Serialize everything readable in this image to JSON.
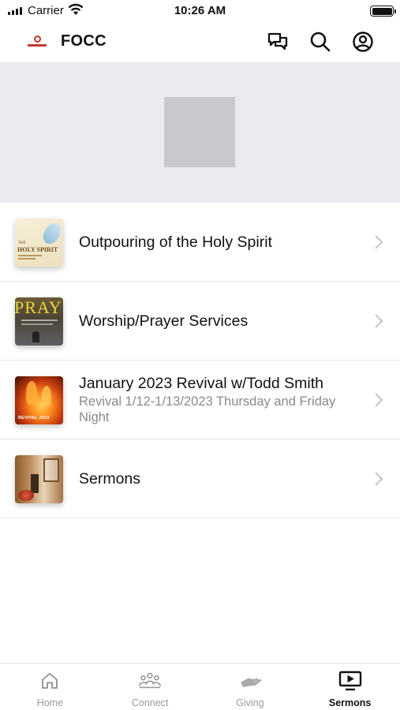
{
  "status_bar": {
    "carrier": "Carrier",
    "time": "10:26 AM",
    "icons": [
      "signal-icon",
      "wifi-icon",
      "battery-icon"
    ]
  },
  "header": {
    "title": "FOCC",
    "logo": "church-logo",
    "buttons": [
      "chat-icon",
      "search-icon",
      "profile-icon"
    ]
  },
  "banner": {
    "image": "placeholder-image"
  },
  "list": {
    "items": [
      {
        "title": "Outpouring of the Holy Spirit",
        "subtitle": "",
        "thumbnail_text": [
          "THE",
          "HOLY SPIRIT"
        ]
      },
      {
        "title": "Worship/Prayer Services",
        "subtitle": "",
        "thumbnail_text": [
          "PRAY"
        ]
      },
      {
        "title": "January 2023 Revival w/Todd Smith",
        "subtitle": "Revival 1/12-1/13/2023 Thursday and Friday Night",
        "thumbnail_text": [
          "REVIVAL 2023"
        ]
      },
      {
        "title": "Sermons",
        "subtitle": "",
        "thumbnail_text": []
      }
    ]
  },
  "tabbar": {
    "tabs": [
      {
        "label": "Home",
        "icon": "home-icon",
        "active": false
      },
      {
        "label": "Connect",
        "icon": "people-icon",
        "active": false
      },
      {
        "label": "Giving",
        "icon": "giving-hand-icon",
        "active": false
      },
      {
        "label": "Sermons",
        "icon": "play-screen-icon",
        "active": true
      }
    ]
  },
  "colors": {
    "banner_bg": "#eaebee",
    "placeholder": "#c8c9cd",
    "tab_inactive": "#9a9a9e",
    "tab_active": "#111111",
    "subtitle": "#8a8a8e"
  }
}
